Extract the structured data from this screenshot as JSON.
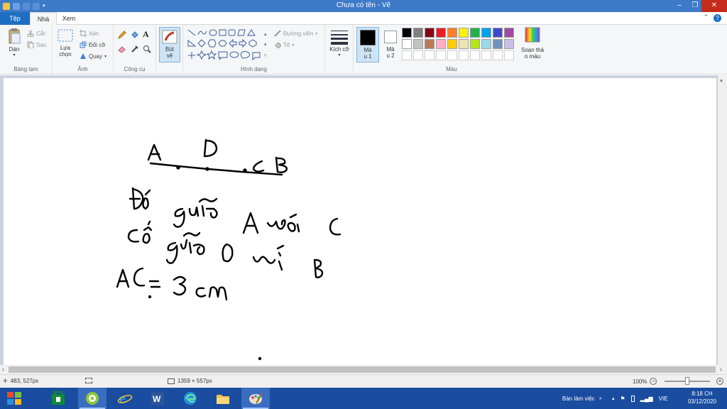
{
  "window": {
    "title": "Chưa có tên - Vẽ"
  },
  "tabs": {
    "file": "Tệp",
    "home": "Nhà",
    "view": "Xem"
  },
  "ribbon": {
    "clipboard": {
      "paste": "Dán",
      "cut": "Cắt",
      "copy": "Sao",
      "label": "Bảng tạm"
    },
    "image": {
      "select": "Lựa chọn",
      "crop": "Xén",
      "resize": "Đổi cỡ",
      "rotate": "Quay",
      "label": "Ảnh"
    },
    "tools": {
      "label": "Công cụ"
    },
    "brushes": {
      "label": "Bút vẽ"
    },
    "shapes": {
      "outline": "Đường viền",
      "fill": "Tô",
      "label": "Hình dạng"
    },
    "size": {
      "label": "Kích cỡ"
    },
    "colors": {
      "color1": "Mà u 1",
      "color2": "Mà u 2",
      "edit": "Soạn thả o màu",
      "label": "Màu",
      "color1_value": "#000000",
      "color2_value": "#ffffff",
      "palette_row1": [
        "#000000",
        "#7f7f7f",
        "#880015",
        "#ed1c24",
        "#ff7f27",
        "#fff200",
        "#22b14c",
        "#00a2e8",
        "#3f48cc",
        "#a349a4"
      ],
      "palette_row2": [
        "#ffffff",
        "#c3c3c3",
        "#b97a57",
        "#ffaec9",
        "#ffc90e",
        "#efe4b0",
        "#b5e61d",
        "#99d9ea",
        "#7092be",
        "#c8bfe7"
      ]
    }
  },
  "status": {
    "cursor": "483, 527px",
    "canvas_size": "1359 × 557px",
    "zoom": "100%"
  },
  "taskbar": {
    "desktop": "Bàn làm việc",
    "lang": "VIE",
    "time": "8:18 CH",
    "date": "03/12/2020"
  }
}
